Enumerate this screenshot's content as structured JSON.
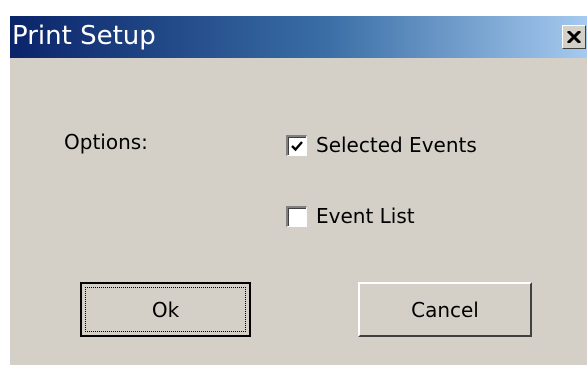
{
  "dialog": {
    "title": "Print Setup",
    "close_icon": "close-icon"
  },
  "options": {
    "label": "Options:",
    "selected_events": {
      "label": "Selected Events",
      "checked": true
    },
    "event_list": {
      "label": "Event List",
      "checked": false
    }
  },
  "buttons": {
    "ok_label": "Ok",
    "cancel_label": "Cancel"
  },
  "colors": {
    "title_gradient_start": "#0a246a",
    "title_gradient_end": "#a6caf0",
    "face": "#d4d0c8"
  }
}
